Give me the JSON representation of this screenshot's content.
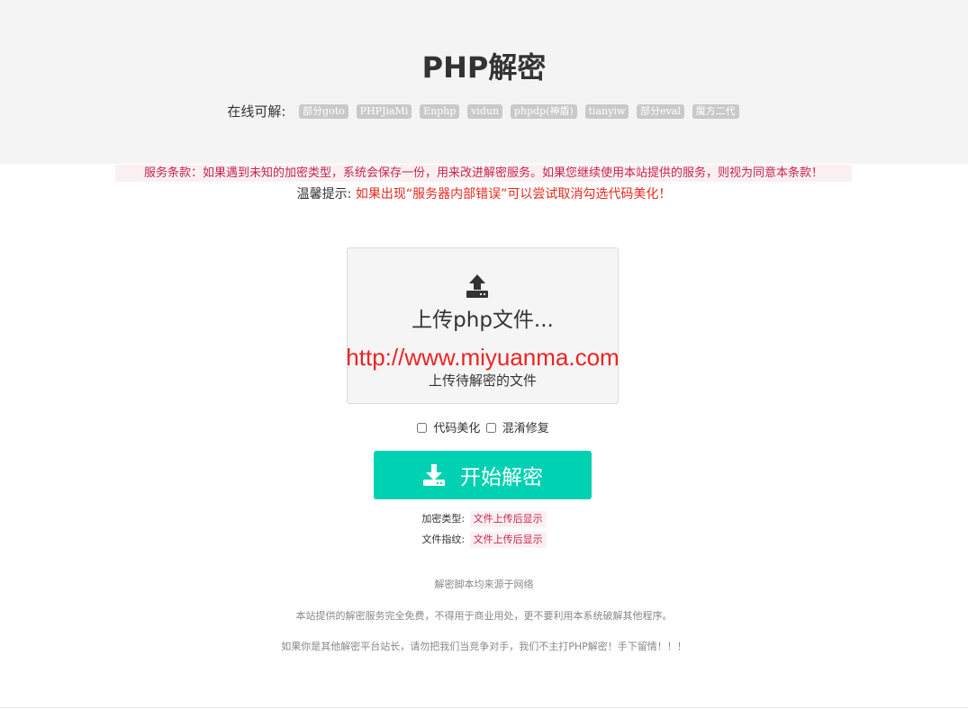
{
  "header": {
    "title": "PHP解密",
    "online_label": "在线可解:",
    "tags": [
      "部分goto",
      "PHPJiaMi",
      "Enphp",
      "vidun",
      "phpdp(神盾)",
      "tianyiw",
      "部分eval",
      "魔方二代"
    ]
  },
  "notices": {
    "terms": "服务条款：如果遇到未知的加密类型，系统会保存一份，用来改进解密服务。如果您继续使用本站提供的服务，则视为同意本条款！",
    "tip_label": "温馨提示:",
    "tip_text": "如果出现“服务器内部错误”可以尝试取消勾选代码美化！"
  },
  "upload": {
    "title": "上传php文件...",
    "watermark": "http://www.miyuanma.com",
    "subtitle": "上传待解密的文件"
  },
  "options": {
    "beautify_label": "代码美化",
    "beautify_checked": false,
    "deobfuscate_label": "混淆修复",
    "deobfuscate_checked": false
  },
  "actions": {
    "start_label": "开始解密"
  },
  "result": {
    "type_label": "加密类型:",
    "type_value": "文件上传后显示",
    "fingerprint_label": "文件指纹:",
    "fingerprint_value": "文件上传后显示"
  },
  "footer": {
    "line1": "解密脚本均来源于网络",
    "line2": "本站提供的解密服务完全免费，不得用于商业用处，更不要利用本系统破解其他程序。",
    "line3": "如果你是其他解密平台站长，请勿把我们当竞争对手，我们不主打PHP解密！手下留情！！！"
  },
  "colors": {
    "accent": "#00d1b2",
    "alert": "#c7254e",
    "warning": "#e8271d",
    "header_bg": "#f4f4f4"
  },
  "icons": {
    "upload": "upload-icon",
    "download": "download-icon"
  }
}
